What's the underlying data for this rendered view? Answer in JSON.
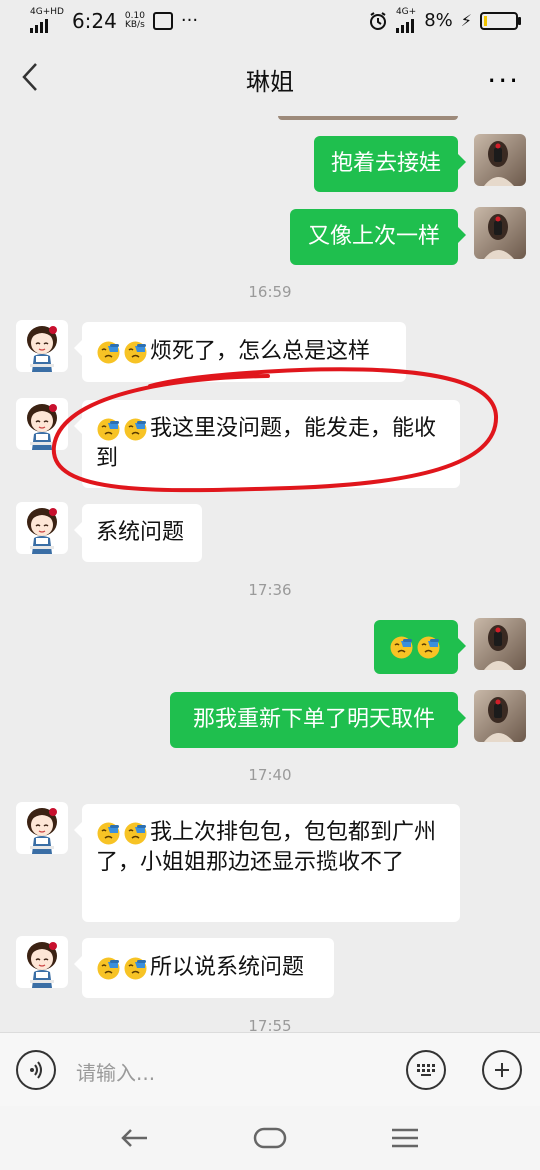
{
  "status_bar": {
    "network": "4G+HD",
    "time": "6:24",
    "speed_value": "0.10",
    "speed_unit": "KB/s",
    "more": "···",
    "network_right": "4G+",
    "battery": "8%",
    "battery_level": 0.08
  },
  "header": {
    "title": "琳姐",
    "more": "···"
  },
  "messages": [
    {
      "side": "out",
      "text": "抱着去接娃"
    },
    {
      "side": "out",
      "text": "又像上次一样"
    },
    {
      "type": "time",
      "text": "16:59"
    },
    {
      "side": "in",
      "emoji_count": 2,
      "text": "烦死了，怎么总是这样"
    },
    {
      "side": "in",
      "emoji_count": 2,
      "text": "我这里没问题，能发走，能收到",
      "highlighted": true
    },
    {
      "side": "in",
      "text": "系统问题"
    },
    {
      "type": "time",
      "text": "17:36"
    },
    {
      "side": "out",
      "emoji_count": 2,
      "text": ""
    },
    {
      "side": "out",
      "text": "那我重新下单了明天取件"
    },
    {
      "type": "time",
      "text": "17:40"
    },
    {
      "side": "in",
      "emoji_count": 2,
      "text": "我上次排包包，包包都到广州了，小姐姐那边还显示揽收不了"
    },
    {
      "side": "in",
      "emoji_count": 2,
      "text": "所以说系统问题"
    },
    {
      "type": "time",
      "text": "17:55"
    }
  ],
  "input_bar": {
    "placeholder": "请输入..."
  },
  "colors": {
    "sent_bubble": "#1fbf4e",
    "received_bubble": "#ffffff",
    "background": "#ededed",
    "highlight_circle": "#e0161c"
  }
}
